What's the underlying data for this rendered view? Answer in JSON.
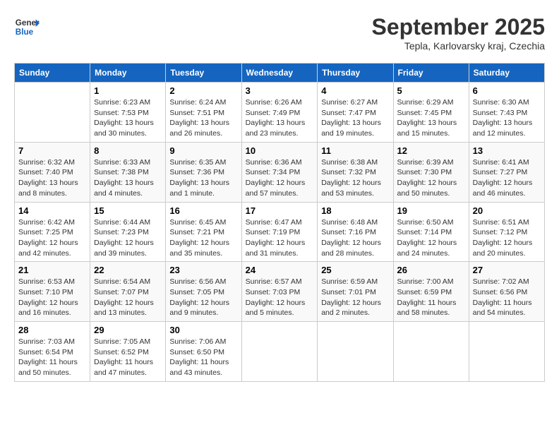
{
  "header": {
    "logo_line1": "General",
    "logo_line2": "Blue",
    "month": "September 2025",
    "location": "Tepla, Karlovarsky kraj, Czechia"
  },
  "days_of_week": [
    "Sunday",
    "Monday",
    "Tuesday",
    "Wednesday",
    "Thursday",
    "Friday",
    "Saturday"
  ],
  "weeks": [
    [
      {
        "num": "",
        "info": ""
      },
      {
        "num": "1",
        "info": "Sunrise: 6:23 AM\nSunset: 7:53 PM\nDaylight: 13 hours\nand 30 minutes."
      },
      {
        "num": "2",
        "info": "Sunrise: 6:24 AM\nSunset: 7:51 PM\nDaylight: 13 hours\nand 26 minutes."
      },
      {
        "num": "3",
        "info": "Sunrise: 6:26 AM\nSunset: 7:49 PM\nDaylight: 13 hours\nand 23 minutes."
      },
      {
        "num": "4",
        "info": "Sunrise: 6:27 AM\nSunset: 7:47 PM\nDaylight: 13 hours\nand 19 minutes."
      },
      {
        "num": "5",
        "info": "Sunrise: 6:29 AM\nSunset: 7:45 PM\nDaylight: 13 hours\nand 15 minutes."
      },
      {
        "num": "6",
        "info": "Sunrise: 6:30 AM\nSunset: 7:43 PM\nDaylight: 13 hours\nand 12 minutes."
      }
    ],
    [
      {
        "num": "7",
        "info": "Sunrise: 6:32 AM\nSunset: 7:40 PM\nDaylight: 13 hours\nand 8 minutes."
      },
      {
        "num": "8",
        "info": "Sunrise: 6:33 AM\nSunset: 7:38 PM\nDaylight: 13 hours\nand 4 minutes."
      },
      {
        "num": "9",
        "info": "Sunrise: 6:35 AM\nSunset: 7:36 PM\nDaylight: 13 hours\nand 1 minute."
      },
      {
        "num": "10",
        "info": "Sunrise: 6:36 AM\nSunset: 7:34 PM\nDaylight: 12 hours\nand 57 minutes."
      },
      {
        "num": "11",
        "info": "Sunrise: 6:38 AM\nSunset: 7:32 PM\nDaylight: 12 hours\nand 53 minutes."
      },
      {
        "num": "12",
        "info": "Sunrise: 6:39 AM\nSunset: 7:30 PM\nDaylight: 12 hours\nand 50 minutes."
      },
      {
        "num": "13",
        "info": "Sunrise: 6:41 AM\nSunset: 7:27 PM\nDaylight: 12 hours\nand 46 minutes."
      }
    ],
    [
      {
        "num": "14",
        "info": "Sunrise: 6:42 AM\nSunset: 7:25 PM\nDaylight: 12 hours\nand 42 minutes."
      },
      {
        "num": "15",
        "info": "Sunrise: 6:44 AM\nSunset: 7:23 PM\nDaylight: 12 hours\nand 39 minutes."
      },
      {
        "num": "16",
        "info": "Sunrise: 6:45 AM\nSunset: 7:21 PM\nDaylight: 12 hours\nand 35 minutes."
      },
      {
        "num": "17",
        "info": "Sunrise: 6:47 AM\nSunset: 7:19 PM\nDaylight: 12 hours\nand 31 minutes."
      },
      {
        "num": "18",
        "info": "Sunrise: 6:48 AM\nSunset: 7:16 PM\nDaylight: 12 hours\nand 28 minutes."
      },
      {
        "num": "19",
        "info": "Sunrise: 6:50 AM\nSunset: 7:14 PM\nDaylight: 12 hours\nand 24 minutes."
      },
      {
        "num": "20",
        "info": "Sunrise: 6:51 AM\nSunset: 7:12 PM\nDaylight: 12 hours\nand 20 minutes."
      }
    ],
    [
      {
        "num": "21",
        "info": "Sunrise: 6:53 AM\nSunset: 7:10 PM\nDaylight: 12 hours\nand 16 minutes."
      },
      {
        "num": "22",
        "info": "Sunrise: 6:54 AM\nSunset: 7:07 PM\nDaylight: 12 hours\nand 13 minutes."
      },
      {
        "num": "23",
        "info": "Sunrise: 6:56 AM\nSunset: 7:05 PM\nDaylight: 12 hours\nand 9 minutes."
      },
      {
        "num": "24",
        "info": "Sunrise: 6:57 AM\nSunset: 7:03 PM\nDaylight: 12 hours\nand 5 minutes."
      },
      {
        "num": "25",
        "info": "Sunrise: 6:59 AM\nSunset: 7:01 PM\nDaylight: 12 hours\nand 2 minutes."
      },
      {
        "num": "26",
        "info": "Sunrise: 7:00 AM\nSunset: 6:59 PM\nDaylight: 11 hours\nand 58 minutes."
      },
      {
        "num": "27",
        "info": "Sunrise: 7:02 AM\nSunset: 6:56 PM\nDaylight: 11 hours\nand 54 minutes."
      }
    ],
    [
      {
        "num": "28",
        "info": "Sunrise: 7:03 AM\nSunset: 6:54 PM\nDaylight: 11 hours\nand 50 minutes."
      },
      {
        "num": "29",
        "info": "Sunrise: 7:05 AM\nSunset: 6:52 PM\nDaylight: 11 hours\nand 47 minutes."
      },
      {
        "num": "30",
        "info": "Sunrise: 7:06 AM\nSunset: 6:50 PM\nDaylight: 11 hours\nand 43 minutes."
      },
      {
        "num": "",
        "info": ""
      },
      {
        "num": "",
        "info": ""
      },
      {
        "num": "",
        "info": ""
      },
      {
        "num": "",
        "info": ""
      }
    ]
  ]
}
